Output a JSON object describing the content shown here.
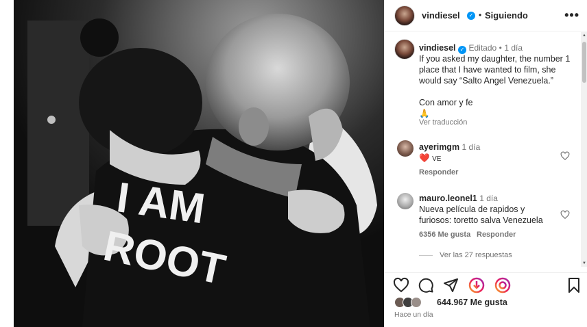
{
  "post": {
    "author": "vindiesel",
    "follow_status": "Siguiendo",
    "more_label": "•••",
    "separator": "•",
    "caption": {
      "edited": "Editado",
      "time": "1 día",
      "text": "If you asked my daughter, the number 1 place that I have wanted to film, she would say “Salto Angel Venezuela.”",
      "signoff": "Con amor y fe",
      "emoji": "🙏",
      "translate": "Ver traducción"
    },
    "shirt_text": [
      "I AM",
      "ROOT"
    ]
  },
  "comments": [
    {
      "user": "ayerimgm",
      "time": "1 día",
      "text": "VE",
      "emoji": "❤️",
      "actions": [
        "Responder"
      ]
    },
    {
      "user": "mauro.leonel1",
      "time": "1 día",
      "text": "Nueva película de rapidos y furiosos: toretto salva Venezuela",
      "likes": "6356 Me gusta",
      "actions": [
        "Responder"
      ],
      "view_replies": "Ver las 27 respuestas"
    }
  ],
  "footer": {
    "likes": "644.967 Me gusta",
    "timestamp": "Hace un día"
  },
  "colors": {
    "verified": "#0095f6",
    "heart": "#ed4956",
    "muted": "#737373"
  },
  "icons": [
    "heart-icon",
    "comment-icon",
    "share-icon",
    "gift-icon",
    "reel-icon",
    "bookmark-icon"
  ]
}
